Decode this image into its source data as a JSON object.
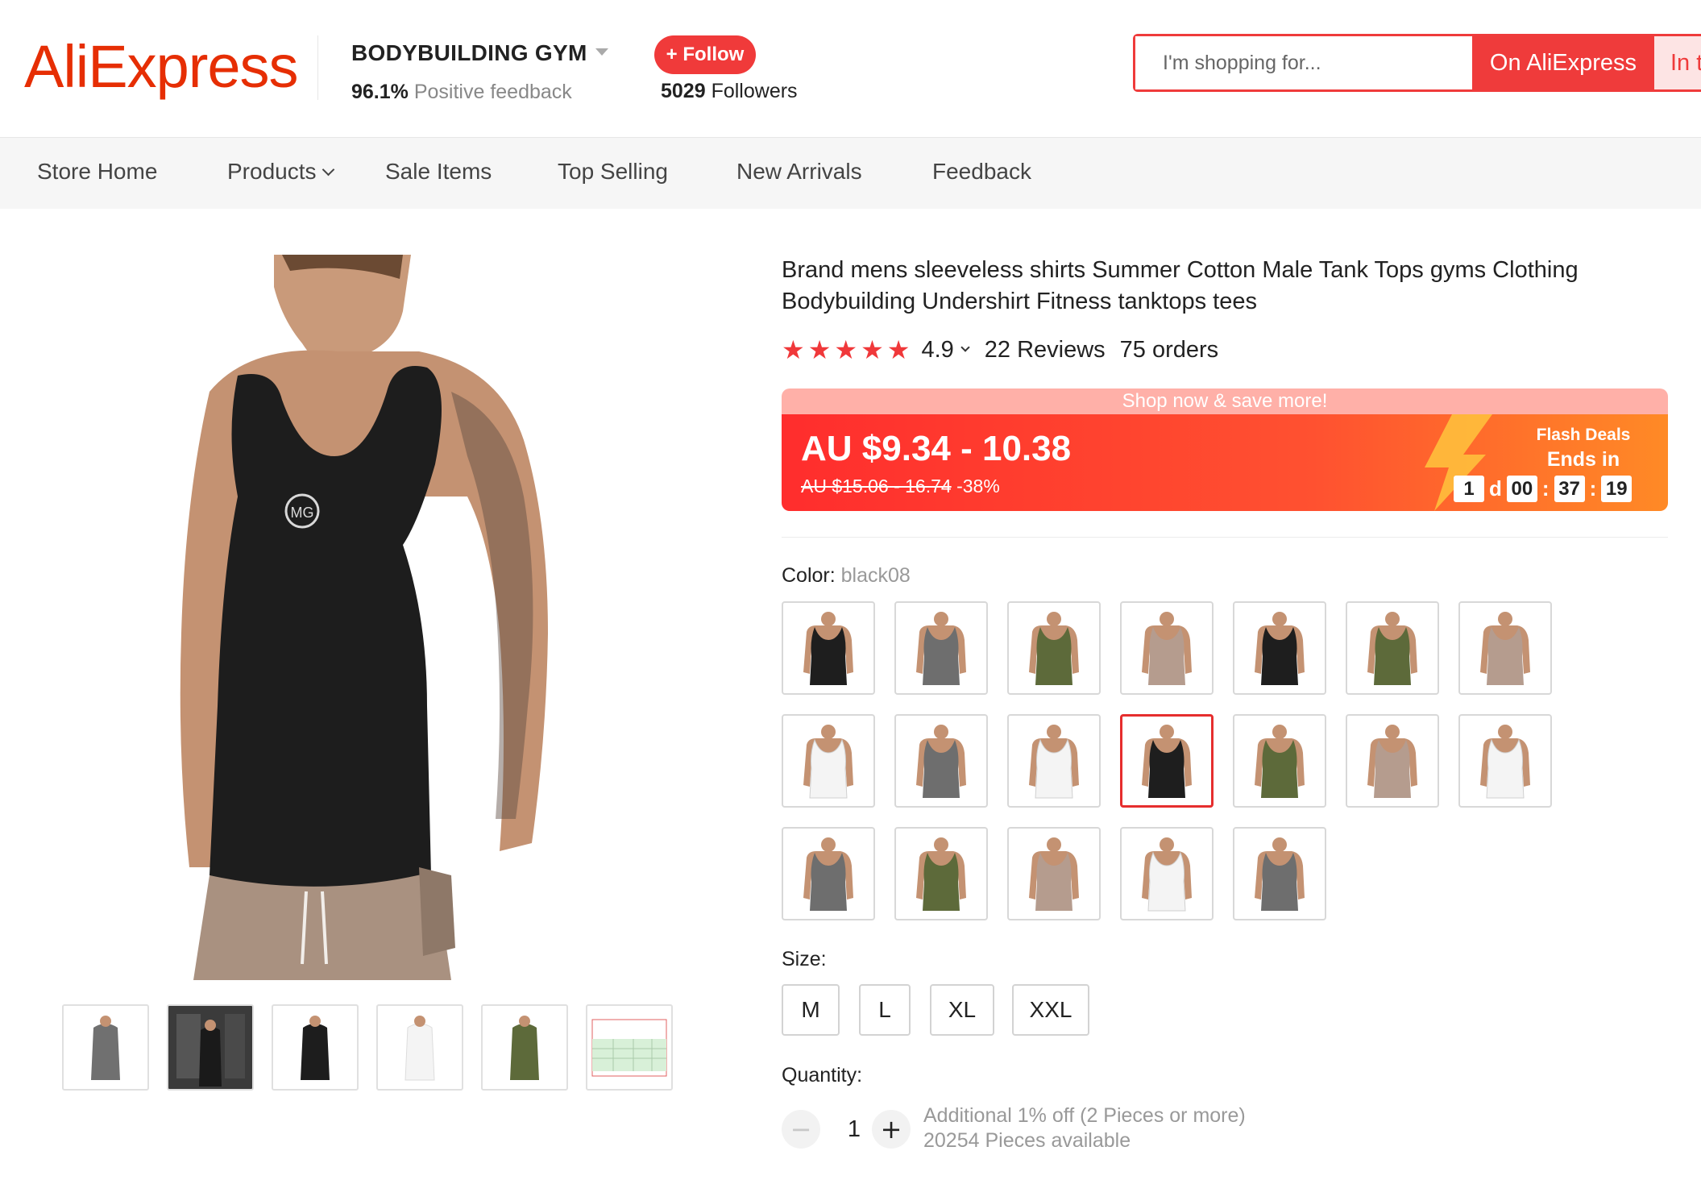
{
  "brand": {
    "logo_text": "AliExpress",
    "color": "#e62e04"
  },
  "store": {
    "name": "BODYBUILDING GYM",
    "feedback_percent": "96.1%",
    "feedback_label": "Positive feedback",
    "follow_label": "+ Follow",
    "followers_count": "5029",
    "followers_label": "Followers"
  },
  "search": {
    "placeholder": "I'm shopping for...",
    "button_aliexpress": "On AliExpress",
    "button_store": "In this store"
  },
  "nav": {
    "items": [
      {
        "label": "Store Home"
      },
      {
        "label": "Products",
        "has_dropdown": true
      },
      {
        "label": "Sale Items"
      },
      {
        "label": "Top Selling"
      },
      {
        "label": "New Arrivals"
      },
      {
        "label": "Feedback"
      }
    ]
  },
  "gallery": {
    "main_color": "black",
    "thumbs": [
      {
        "shirt": "grey"
      },
      {
        "shirt": "photo"
      },
      {
        "shirt": "black"
      },
      {
        "shirt": "white"
      },
      {
        "shirt": "green"
      },
      {
        "shirt": "size-chart"
      }
    ]
  },
  "product": {
    "title": "Brand mens sleeveless shirts Summer Cotton Male Tank Tops gyms Clothing Bodybuilding Undershirt Fitness tanktops tees",
    "rating": "4.9",
    "stars": 5,
    "reviews": "22 Reviews",
    "orders": "75 orders"
  },
  "price": {
    "banner": "Shop now & save more!",
    "current": "AU $9.34 - 10.38",
    "original": "AU $15.06 - 16.74",
    "discount": "-38%",
    "flash_label": "Flash Deals",
    "ends_in_label": "Ends in",
    "countdown": {
      "days": "1",
      "day_unit": "d",
      "hours": "00",
      "minutes": "37",
      "seconds": "19"
    },
    "colors": {
      "start": "#ff2d2d",
      "end": "#ff8a26"
    }
  },
  "color_option": {
    "label": "Color:",
    "selected": "black08",
    "swatches": [
      {
        "shirt": "black"
      },
      {
        "shirt": "grey"
      },
      {
        "shirt": "green"
      },
      {
        "shirt": "tan"
      },
      {
        "shirt": "black"
      },
      {
        "shirt": "green"
      },
      {
        "shirt": "tan"
      },
      {
        "shirt": "white"
      },
      {
        "shirt": "grey"
      },
      {
        "shirt": "white"
      },
      {
        "shirt": "black",
        "selected": true
      },
      {
        "shirt": "green"
      },
      {
        "shirt": "tan"
      },
      {
        "shirt": "white"
      },
      {
        "shirt": "grey"
      },
      {
        "shirt": "green"
      },
      {
        "shirt": "tan"
      },
      {
        "shirt": "white"
      },
      {
        "shirt": "grey"
      }
    ]
  },
  "size_option": {
    "label": "Size:",
    "sizes": [
      "M",
      "L",
      "XL",
      "XXL"
    ]
  },
  "quantity": {
    "label": "Quantity:",
    "minus": "−",
    "value": "1",
    "plus": "+",
    "discount_note": "Additional 1% off (2 Pieces or more)",
    "available": "20254 Pieces available"
  }
}
